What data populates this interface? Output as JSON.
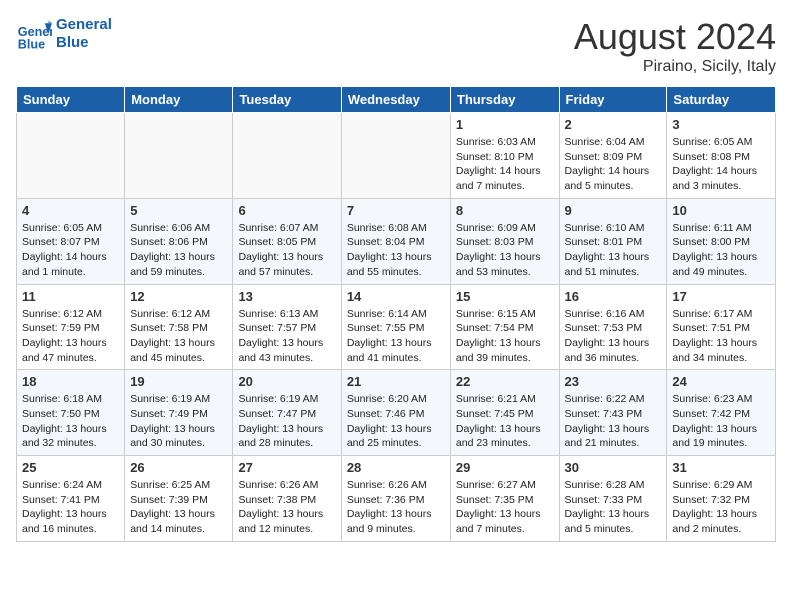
{
  "header": {
    "logo_line1": "General",
    "logo_line2": "Blue",
    "month_title": "August 2024",
    "location": "Piraino, Sicily, Italy"
  },
  "weekdays": [
    "Sunday",
    "Monday",
    "Tuesday",
    "Wednesday",
    "Thursday",
    "Friday",
    "Saturday"
  ],
  "weeks": [
    [
      {
        "day": "",
        "info": ""
      },
      {
        "day": "",
        "info": ""
      },
      {
        "day": "",
        "info": ""
      },
      {
        "day": "",
        "info": ""
      },
      {
        "day": "1",
        "info": "Sunrise: 6:03 AM\nSunset: 8:10 PM\nDaylight: 14 hours\nand 7 minutes."
      },
      {
        "day": "2",
        "info": "Sunrise: 6:04 AM\nSunset: 8:09 PM\nDaylight: 14 hours\nand 5 minutes."
      },
      {
        "day": "3",
        "info": "Sunrise: 6:05 AM\nSunset: 8:08 PM\nDaylight: 14 hours\nand 3 minutes."
      }
    ],
    [
      {
        "day": "4",
        "info": "Sunrise: 6:05 AM\nSunset: 8:07 PM\nDaylight: 14 hours\nand 1 minute."
      },
      {
        "day": "5",
        "info": "Sunrise: 6:06 AM\nSunset: 8:06 PM\nDaylight: 13 hours\nand 59 minutes."
      },
      {
        "day": "6",
        "info": "Sunrise: 6:07 AM\nSunset: 8:05 PM\nDaylight: 13 hours\nand 57 minutes."
      },
      {
        "day": "7",
        "info": "Sunrise: 6:08 AM\nSunset: 8:04 PM\nDaylight: 13 hours\nand 55 minutes."
      },
      {
        "day": "8",
        "info": "Sunrise: 6:09 AM\nSunset: 8:03 PM\nDaylight: 13 hours\nand 53 minutes."
      },
      {
        "day": "9",
        "info": "Sunrise: 6:10 AM\nSunset: 8:01 PM\nDaylight: 13 hours\nand 51 minutes."
      },
      {
        "day": "10",
        "info": "Sunrise: 6:11 AM\nSunset: 8:00 PM\nDaylight: 13 hours\nand 49 minutes."
      }
    ],
    [
      {
        "day": "11",
        "info": "Sunrise: 6:12 AM\nSunset: 7:59 PM\nDaylight: 13 hours\nand 47 minutes."
      },
      {
        "day": "12",
        "info": "Sunrise: 6:12 AM\nSunset: 7:58 PM\nDaylight: 13 hours\nand 45 minutes."
      },
      {
        "day": "13",
        "info": "Sunrise: 6:13 AM\nSunset: 7:57 PM\nDaylight: 13 hours\nand 43 minutes."
      },
      {
        "day": "14",
        "info": "Sunrise: 6:14 AM\nSunset: 7:55 PM\nDaylight: 13 hours\nand 41 minutes."
      },
      {
        "day": "15",
        "info": "Sunrise: 6:15 AM\nSunset: 7:54 PM\nDaylight: 13 hours\nand 39 minutes."
      },
      {
        "day": "16",
        "info": "Sunrise: 6:16 AM\nSunset: 7:53 PM\nDaylight: 13 hours\nand 36 minutes."
      },
      {
        "day": "17",
        "info": "Sunrise: 6:17 AM\nSunset: 7:51 PM\nDaylight: 13 hours\nand 34 minutes."
      }
    ],
    [
      {
        "day": "18",
        "info": "Sunrise: 6:18 AM\nSunset: 7:50 PM\nDaylight: 13 hours\nand 32 minutes."
      },
      {
        "day": "19",
        "info": "Sunrise: 6:19 AM\nSunset: 7:49 PM\nDaylight: 13 hours\nand 30 minutes."
      },
      {
        "day": "20",
        "info": "Sunrise: 6:19 AM\nSunset: 7:47 PM\nDaylight: 13 hours\nand 28 minutes."
      },
      {
        "day": "21",
        "info": "Sunrise: 6:20 AM\nSunset: 7:46 PM\nDaylight: 13 hours\nand 25 minutes."
      },
      {
        "day": "22",
        "info": "Sunrise: 6:21 AM\nSunset: 7:45 PM\nDaylight: 13 hours\nand 23 minutes."
      },
      {
        "day": "23",
        "info": "Sunrise: 6:22 AM\nSunset: 7:43 PM\nDaylight: 13 hours\nand 21 minutes."
      },
      {
        "day": "24",
        "info": "Sunrise: 6:23 AM\nSunset: 7:42 PM\nDaylight: 13 hours\nand 19 minutes."
      }
    ],
    [
      {
        "day": "25",
        "info": "Sunrise: 6:24 AM\nSunset: 7:41 PM\nDaylight: 13 hours\nand 16 minutes."
      },
      {
        "day": "26",
        "info": "Sunrise: 6:25 AM\nSunset: 7:39 PM\nDaylight: 13 hours\nand 14 minutes."
      },
      {
        "day": "27",
        "info": "Sunrise: 6:26 AM\nSunset: 7:38 PM\nDaylight: 13 hours\nand 12 minutes."
      },
      {
        "day": "28",
        "info": "Sunrise: 6:26 AM\nSunset: 7:36 PM\nDaylight: 13 hours\nand 9 minutes."
      },
      {
        "day": "29",
        "info": "Sunrise: 6:27 AM\nSunset: 7:35 PM\nDaylight: 13 hours\nand 7 minutes."
      },
      {
        "day": "30",
        "info": "Sunrise: 6:28 AM\nSunset: 7:33 PM\nDaylight: 13 hours\nand 5 minutes."
      },
      {
        "day": "31",
        "info": "Sunrise: 6:29 AM\nSunset: 7:32 PM\nDaylight: 13 hours\nand 2 minutes."
      }
    ]
  ]
}
